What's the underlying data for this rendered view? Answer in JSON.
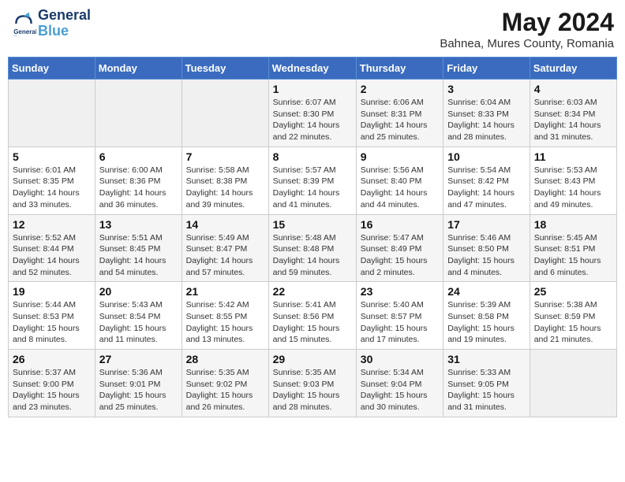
{
  "header": {
    "logo_line1": "General",
    "logo_line2": "Blue",
    "month_year": "May 2024",
    "location": "Bahnea, Mures County, Romania"
  },
  "days_of_week": [
    "Sunday",
    "Monday",
    "Tuesday",
    "Wednesday",
    "Thursday",
    "Friday",
    "Saturday"
  ],
  "weeks": [
    [
      {
        "day": "",
        "sunrise": "",
        "sunset": "",
        "daylight": ""
      },
      {
        "day": "",
        "sunrise": "",
        "sunset": "",
        "daylight": ""
      },
      {
        "day": "",
        "sunrise": "",
        "sunset": "",
        "daylight": ""
      },
      {
        "day": "1",
        "sunrise": "Sunrise: 6:07 AM",
        "sunset": "Sunset: 8:30 PM",
        "daylight": "Daylight: 14 hours and 22 minutes."
      },
      {
        "day": "2",
        "sunrise": "Sunrise: 6:06 AM",
        "sunset": "Sunset: 8:31 PM",
        "daylight": "Daylight: 14 hours and 25 minutes."
      },
      {
        "day": "3",
        "sunrise": "Sunrise: 6:04 AM",
        "sunset": "Sunset: 8:33 PM",
        "daylight": "Daylight: 14 hours and 28 minutes."
      },
      {
        "day": "4",
        "sunrise": "Sunrise: 6:03 AM",
        "sunset": "Sunset: 8:34 PM",
        "daylight": "Daylight: 14 hours and 31 minutes."
      }
    ],
    [
      {
        "day": "5",
        "sunrise": "Sunrise: 6:01 AM",
        "sunset": "Sunset: 8:35 PM",
        "daylight": "Daylight: 14 hours and 33 minutes."
      },
      {
        "day": "6",
        "sunrise": "Sunrise: 6:00 AM",
        "sunset": "Sunset: 8:36 PM",
        "daylight": "Daylight: 14 hours and 36 minutes."
      },
      {
        "day": "7",
        "sunrise": "Sunrise: 5:58 AM",
        "sunset": "Sunset: 8:38 PM",
        "daylight": "Daylight: 14 hours and 39 minutes."
      },
      {
        "day": "8",
        "sunrise": "Sunrise: 5:57 AM",
        "sunset": "Sunset: 8:39 PM",
        "daylight": "Daylight: 14 hours and 41 minutes."
      },
      {
        "day": "9",
        "sunrise": "Sunrise: 5:56 AM",
        "sunset": "Sunset: 8:40 PM",
        "daylight": "Daylight: 14 hours and 44 minutes."
      },
      {
        "day": "10",
        "sunrise": "Sunrise: 5:54 AM",
        "sunset": "Sunset: 8:42 PM",
        "daylight": "Daylight: 14 hours and 47 minutes."
      },
      {
        "day": "11",
        "sunrise": "Sunrise: 5:53 AM",
        "sunset": "Sunset: 8:43 PM",
        "daylight": "Daylight: 14 hours and 49 minutes."
      }
    ],
    [
      {
        "day": "12",
        "sunrise": "Sunrise: 5:52 AM",
        "sunset": "Sunset: 8:44 PM",
        "daylight": "Daylight: 14 hours and 52 minutes."
      },
      {
        "day": "13",
        "sunrise": "Sunrise: 5:51 AM",
        "sunset": "Sunset: 8:45 PM",
        "daylight": "Daylight: 14 hours and 54 minutes."
      },
      {
        "day": "14",
        "sunrise": "Sunrise: 5:49 AM",
        "sunset": "Sunset: 8:47 PM",
        "daylight": "Daylight: 14 hours and 57 minutes."
      },
      {
        "day": "15",
        "sunrise": "Sunrise: 5:48 AM",
        "sunset": "Sunset: 8:48 PM",
        "daylight": "Daylight: 14 hours and 59 minutes."
      },
      {
        "day": "16",
        "sunrise": "Sunrise: 5:47 AM",
        "sunset": "Sunset: 8:49 PM",
        "daylight": "Daylight: 15 hours and 2 minutes."
      },
      {
        "day": "17",
        "sunrise": "Sunrise: 5:46 AM",
        "sunset": "Sunset: 8:50 PM",
        "daylight": "Daylight: 15 hours and 4 minutes."
      },
      {
        "day": "18",
        "sunrise": "Sunrise: 5:45 AM",
        "sunset": "Sunset: 8:51 PM",
        "daylight": "Daylight: 15 hours and 6 minutes."
      }
    ],
    [
      {
        "day": "19",
        "sunrise": "Sunrise: 5:44 AM",
        "sunset": "Sunset: 8:53 PM",
        "daylight": "Daylight: 15 hours and 8 minutes."
      },
      {
        "day": "20",
        "sunrise": "Sunrise: 5:43 AM",
        "sunset": "Sunset: 8:54 PM",
        "daylight": "Daylight: 15 hours and 11 minutes."
      },
      {
        "day": "21",
        "sunrise": "Sunrise: 5:42 AM",
        "sunset": "Sunset: 8:55 PM",
        "daylight": "Daylight: 15 hours and 13 minutes."
      },
      {
        "day": "22",
        "sunrise": "Sunrise: 5:41 AM",
        "sunset": "Sunset: 8:56 PM",
        "daylight": "Daylight: 15 hours and 15 minutes."
      },
      {
        "day": "23",
        "sunrise": "Sunrise: 5:40 AM",
        "sunset": "Sunset: 8:57 PM",
        "daylight": "Daylight: 15 hours and 17 minutes."
      },
      {
        "day": "24",
        "sunrise": "Sunrise: 5:39 AM",
        "sunset": "Sunset: 8:58 PM",
        "daylight": "Daylight: 15 hours and 19 minutes."
      },
      {
        "day": "25",
        "sunrise": "Sunrise: 5:38 AM",
        "sunset": "Sunset: 8:59 PM",
        "daylight": "Daylight: 15 hours and 21 minutes."
      }
    ],
    [
      {
        "day": "26",
        "sunrise": "Sunrise: 5:37 AM",
        "sunset": "Sunset: 9:00 PM",
        "daylight": "Daylight: 15 hours and 23 minutes."
      },
      {
        "day": "27",
        "sunrise": "Sunrise: 5:36 AM",
        "sunset": "Sunset: 9:01 PM",
        "daylight": "Daylight: 15 hours and 25 minutes."
      },
      {
        "day": "28",
        "sunrise": "Sunrise: 5:35 AM",
        "sunset": "Sunset: 9:02 PM",
        "daylight": "Daylight: 15 hours and 26 minutes."
      },
      {
        "day": "29",
        "sunrise": "Sunrise: 5:35 AM",
        "sunset": "Sunset: 9:03 PM",
        "daylight": "Daylight: 15 hours and 28 minutes."
      },
      {
        "day": "30",
        "sunrise": "Sunrise: 5:34 AM",
        "sunset": "Sunset: 9:04 PM",
        "daylight": "Daylight: 15 hours and 30 minutes."
      },
      {
        "day": "31",
        "sunrise": "Sunrise: 5:33 AM",
        "sunset": "Sunset: 9:05 PM",
        "daylight": "Daylight: 15 hours and 31 minutes."
      },
      {
        "day": "",
        "sunrise": "",
        "sunset": "",
        "daylight": ""
      }
    ]
  ]
}
